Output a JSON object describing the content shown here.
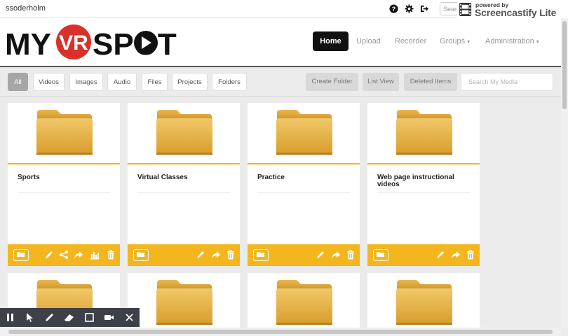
{
  "topbar": {
    "username": "ssoderholm",
    "search_placeholder": "Search",
    "icons": [
      "help-icon",
      "gear-icon",
      "logout-icon"
    ]
  },
  "watermark": {
    "powered": "powered by",
    "name": "Screencastify Lite"
  },
  "logo": {
    "left": "MY",
    "badge": "VR",
    "right": "SPOT"
  },
  "nav": {
    "home": "Home",
    "upload": "Upload",
    "recorder": "Recorder",
    "groups": "Groups",
    "administration": "Administration"
  },
  "filters": [
    "All",
    "Videos",
    "Images",
    "Audio",
    "Files",
    "Projects",
    "Folders"
  ],
  "actions": {
    "create_folder": "Create Folder",
    "list_view": "List View",
    "deleted_items": "Deleted Items",
    "search_placeholder": "Search My Media"
  },
  "cards": [
    {
      "title": "Sports",
      "icons": [
        "folder-open-icon",
        "pencil-icon",
        "share-icon",
        "forward-icon",
        "bar-chart-icon",
        "trash-icon"
      ]
    },
    {
      "title": "Virtual Classes",
      "icons": [
        "folder-open-icon",
        "pencil-icon",
        "forward-icon",
        "trash-icon"
      ]
    },
    {
      "title": "Practice",
      "icons": [
        "folder-open-icon",
        "pencil-icon",
        "forward-icon",
        "trash-icon"
      ]
    },
    {
      "title": "Web page instructional videos",
      "icons": [
        "folder-open-icon",
        "pencil-icon",
        "forward-icon",
        "trash-icon"
      ]
    }
  ],
  "colors": {
    "accent": "#f3b61f",
    "logo_red": "#d9302c",
    "nav_active": "#111111"
  },
  "record_toolbar": [
    "pause-icon",
    "cursor-icon",
    "pen-icon",
    "eraser-icon",
    "rectangle-icon",
    "camera-icon",
    "close-icon"
  ]
}
